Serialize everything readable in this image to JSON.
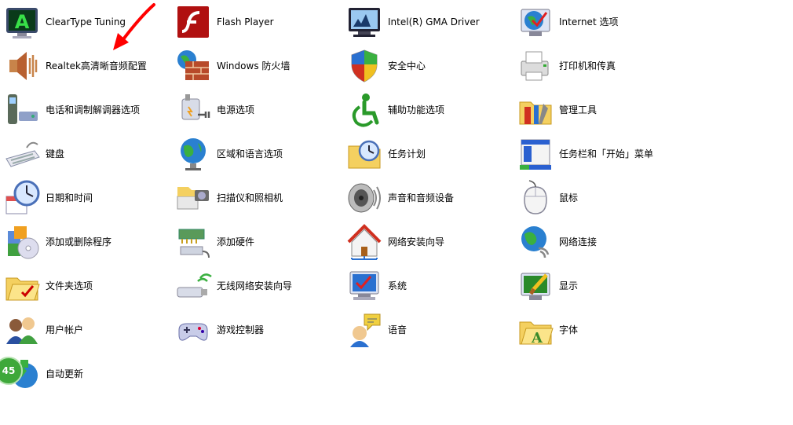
{
  "colors": {
    "background": "#ffffff",
    "arrow": "#ff0000",
    "badge": "#3ea83a"
  },
  "badge": {
    "text": "45"
  },
  "columns": [
    [
      {
        "label": "ClearType Tuning",
        "icon": "cleartype-tuning-icon"
      },
      {
        "label": "Realtek高清晰音频配置",
        "icon": "realtek-audio-icon"
      },
      {
        "label": "电话和调制解调器选项",
        "icon": "phone-modem-icon"
      },
      {
        "label": "键盘",
        "icon": "keyboard-icon"
      },
      {
        "label": "日期和时间",
        "icon": "date-time-icon"
      },
      {
        "label": "添加或删除程序",
        "icon": "add-remove-programs-icon"
      },
      {
        "label": "文件夹选项",
        "icon": "folder-options-icon"
      },
      {
        "label": "用户帐户",
        "icon": "user-accounts-icon"
      },
      {
        "label": "自动更新",
        "icon": "automatic-updates-icon"
      }
    ],
    [
      {
        "label": "Flash Player",
        "icon": "flash-player-icon"
      },
      {
        "label": "Windows 防火墙",
        "icon": "windows-firewall-icon"
      },
      {
        "label": "电源选项",
        "icon": "power-options-icon"
      },
      {
        "label": "区域和语言选项",
        "icon": "regional-language-icon"
      },
      {
        "label": "扫描仪和照相机",
        "icon": "scanner-camera-icon"
      },
      {
        "label": "添加硬件",
        "icon": "add-hardware-icon"
      },
      {
        "label": "无线网络安装向导",
        "icon": "wireless-setup-icon"
      },
      {
        "label": "游戏控制器",
        "icon": "game-controller-icon"
      }
    ],
    [
      {
        "label": "Intel(R) GMA Driver",
        "icon": "intel-gma-icon"
      },
      {
        "label": "安全中心",
        "icon": "security-center-icon"
      },
      {
        "label": "辅助功能选项",
        "icon": "accessibility-icon"
      },
      {
        "label": "任务计划",
        "icon": "scheduled-tasks-icon"
      },
      {
        "label": "声音和音频设备",
        "icon": "sounds-audio-icon"
      },
      {
        "label": "网络安装向导",
        "icon": "network-setup-icon"
      },
      {
        "label": "系统",
        "icon": "system-icon"
      },
      {
        "label": "语音",
        "icon": "speech-icon"
      }
    ],
    [
      {
        "label": "Internet 选项",
        "icon": "internet-options-icon"
      },
      {
        "label": "打印机和传真",
        "icon": "printers-faxes-icon"
      },
      {
        "label": "管理工具",
        "icon": "administrative-tools-icon"
      },
      {
        "label": "任务栏和「开始」菜单",
        "icon": "taskbar-start-menu-icon"
      },
      {
        "label": "鼠标",
        "icon": "mouse-icon"
      },
      {
        "label": "网络连接",
        "icon": "network-connections-icon"
      },
      {
        "label": "显示",
        "icon": "display-icon"
      },
      {
        "label": "字体",
        "icon": "fonts-icon"
      }
    ]
  ]
}
